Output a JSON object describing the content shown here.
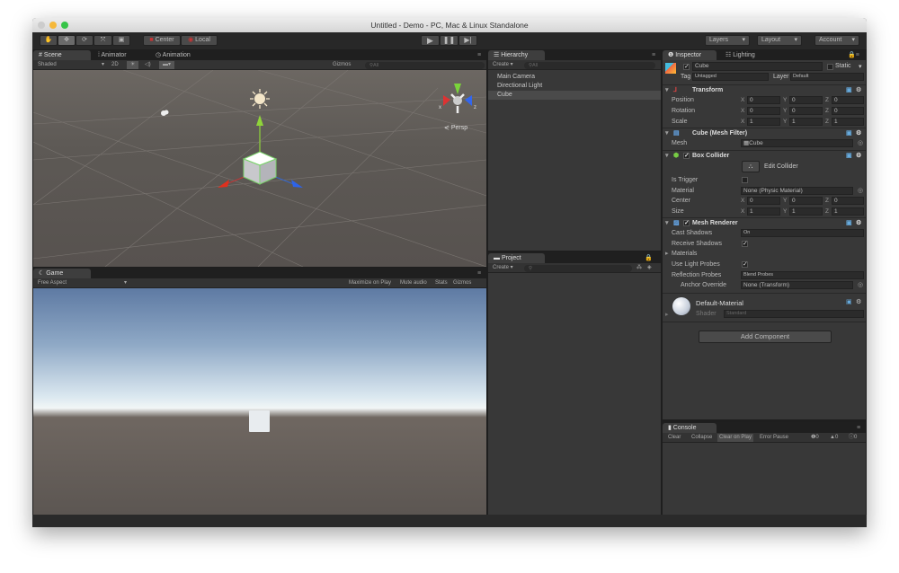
{
  "window": {
    "title": "Untitled - Demo - PC, Mac & Linux Standalone"
  },
  "toolbar": {
    "tools": [
      "hand-icon",
      "move-icon",
      "rotate-icon",
      "scale-icon",
      "rect-icon"
    ],
    "pivot": "Center",
    "space": "Local",
    "layers": "Layers",
    "layout": "Layout",
    "account": "Account"
  },
  "scene": {
    "tabs": [
      "Scene",
      "Animator",
      "Animation"
    ],
    "shading": "Shaded",
    "mode2d": "2D",
    "gizmos": "Gizmos",
    "search_placeholder": "All",
    "persp": "Persp",
    "axis_x": "x",
    "axis_z": "z"
  },
  "game": {
    "tab": "Game",
    "aspect": "Free Aspect",
    "buttons": [
      "Maximize on Play",
      "Mute audio",
      "Stats",
      "Gizmos"
    ]
  },
  "hierarchy": {
    "tab": "Hierarchy",
    "create": "Create",
    "search_placeholder": "All",
    "items": [
      "Main Camera",
      "Directional Light",
      "Cube"
    ],
    "selected": 2
  },
  "project": {
    "tab": "Project",
    "create": "Create"
  },
  "inspector": {
    "tabs": [
      "Inspector",
      "Lighting"
    ],
    "object_name": "Cube",
    "static": "Static",
    "tag_label": "Tag",
    "tag": "Untagged",
    "layer_label": "Layer",
    "layer": "Default",
    "transform": {
      "title": "Transform",
      "rows": [
        {
          "label": "Position",
          "x": "0",
          "y": "0",
          "z": "0"
        },
        {
          "label": "Rotation",
          "x": "0",
          "y": "0",
          "z": "0"
        },
        {
          "label": "Scale",
          "x": "1",
          "y": "1",
          "z": "1"
        }
      ]
    },
    "mesh_filter": {
      "title": "Cube (Mesh Filter)",
      "mesh_label": "Mesh",
      "mesh": "Cube"
    },
    "box_collider": {
      "title": "Box Collider",
      "edit": "Edit Collider",
      "is_trigger": "Is Trigger",
      "material_label": "Material",
      "material": "None (Physic Material)",
      "center": {
        "label": "Center",
        "x": "0",
        "y": "0",
        "z": "0"
      },
      "size": {
        "label": "Size",
        "x": "1",
        "y": "1",
        "z": "1"
      }
    },
    "mesh_renderer": {
      "title": "Mesh Renderer",
      "cast_shadows_label": "Cast Shadows",
      "cast_shadows": "On",
      "receive_shadows": "Receive Shadows",
      "materials": "Materials",
      "use_light_probes": "Use Light Probes",
      "reflection_label": "Reflection Probes",
      "reflection": "Blend Probes",
      "anchor_label": "Anchor Override",
      "anchor": "None (Transform)"
    },
    "material": {
      "name": "Default-Material",
      "shader_label": "Shader",
      "shader": "Standard"
    },
    "add_component": "Add Component"
  },
  "console": {
    "tab": "Console",
    "buttons": [
      "Clear",
      "Collapse",
      "Clear on Play",
      "Error Pause"
    ],
    "counts": {
      "log": "0",
      "warn": "0",
      "error": "0"
    }
  },
  "axes": {
    "x": "X",
    "y": "Y",
    "z": "Z"
  }
}
